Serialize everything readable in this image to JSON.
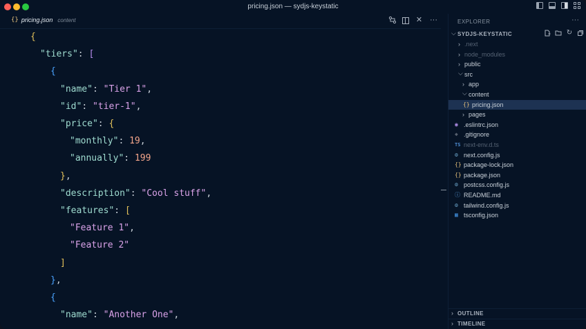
{
  "window": {
    "title": "pricing.json — sydjs-keystatic"
  },
  "tab": {
    "icon": "{}",
    "name": "pricing.json",
    "description": "content"
  },
  "tab_actions": {
    "more": "···"
  },
  "code_lines": [
    [
      [
        "{",
        "b1"
      ]
    ],
    [
      [
        "\"tiers\"",
        "k"
      ],
      [
        ": ",
        "p"
      ],
      [
        "[",
        "b2"
      ]
    ],
    [
      [
        "{",
        "b3"
      ]
    ],
    [
      [
        "\"name\"",
        "k"
      ],
      [
        ": ",
        "p"
      ],
      [
        "\"Tier 1\"",
        "s"
      ],
      [
        ",",
        "p"
      ]
    ],
    [
      [
        "\"id\"",
        "k"
      ],
      [
        ": ",
        "p"
      ],
      [
        "\"tier-1\"",
        "s"
      ],
      [
        ",",
        "p"
      ]
    ],
    [
      [
        "\"price\"",
        "k"
      ],
      [
        ": ",
        "p"
      ],
      [
        "{",
        "b1"
      ]
    ],
    [
      [
        "\"monthly\"",
        "k"
      ],
      [
        ": ",
        "p"
      ],
      [
        "19",
        "n"
      ],
      [
        ",",
        "p"
      ]
    ],
    [
      [
        "\"annually\"",
        "k"
      ],
      [
        ": ",
        "p"
      ],
      [
        "199",
        "n"
      ]
    ],
    [
      [
        "}",
        "b1"
      ],
      [
        ",",
        "p"
      ]
    ],
    [
      [
        "\"description\"",
        "k"
      ],
      [
        ": ",
        "p"
      ],
      [
        "\"Cool stuff\"",
        "s"
      ],
      [
        ",",
        "p"
      ]
    ],
    [
      [
        "\"features\"",
        "k"
      ],
      [
        ": ",
        "p"
      ],
      [
        "[",
        "b1"
      ]
    ],
    [
      [
        "\"Feature 1\"",
        "s"
      ],
      [
        ",",
        "p"
      ]
    ],
    [
      [
        "\"Feature 2\"",
        "s"
      ]
    ],
    [
      [
        "]",
        "b1"
      ]
    ],
    [
      [
        "}",
        "b3"
      ],
      [
        ",",
        "p"
      ]
    ],
    [
      [
        "{",
        "b3"
      ]
    ],
    [
      [
        "\"name\"",
        "k"
      ],
      [
        ": ",
        "p"
      ],
      [
        "\"Another One\"",
        "s"
      ],
      [
        ",",
        "p"
      ]
    ]
  ],
  "explorer": {
    "title": "EXPLORER",
    "more": "···",
    "project": "SYDJS-KEYSTATIC",
    "items": [
      {
        "label": ".next",
        "type": "folder",
        "depth": 1,
        "dim": true,
        "expanded": false
      },
      {
        "label": "node_modules",
        "type": "folder",
        "depth": 1,
        "dim": true,
        "expanded": false
      },
      {
        "label": "public",
        "type": "folder",
        "depth": 1,
        "dim": false,
        "expanded": false
      },
      {
        "label": "src",
        "type": "folder",
        "depth": 1,
        "dim": false,
        "expanded": true
      },
      {
        "label": "app",
        "type": "folder",
        "depth": 2,
        "dim": false,
        "expanded": false
      },
      {
        "label": "content",
        "type": "folder",
        "depth": 2,
        "dim": false,
        "expanded": true
      },
      {
        "label": "pricing.json",
        "type": "file",
        "icon": "json-icon",
        "glyph": "{}",
        "depth": 3,
        "dim": false,
        "selected": true
      },
      {
        "label": "pages",
        "type": "folder",
        "depth": 2,
        "dim": false,
        "expanded": false
      },
      {
        "label": ".eslintrc.json",
        "type": "file",
        "icon": "eslint-icon",
        "glyph": "◉",
        "depth": 1,
        "dim": false
      },
      {
        "label": ".gitignore",
        "type": "file",
        "icon": "git-icon",
        "glyph": "◆",
        "depth": 1,
        "dim": false
      },
      {
        "label": "next-env.d.ts",
        "type": "file",
        "icon": "typescript-icon",
        "glyph": "TS",
        "depth": 1,
        "dim": true
      },
      {
        "label": "next.config.js",
        "type": "file",
        "icon": "gear-icon",
        "glyph": "⚙",
        "depth": 1,
        "dim": false
      },
      {
        "label": "package-lock.json",
        "type": "file",
        "icon": "json-icon",
        "glyph": "{}",
        "depth": 1,
        "dim": false
      },
      {
        "label": "package.json",
        "type": "file",
        "icon": "json-icon",
        "glyph": "{}",
        "depth": 1,
        "dim": false
      },
      {
        "label": "postcss.config.js",
        "type": "file",
        "icon": "gear-icon",
        "glyph": "⚙",
        "depth": 1,
        "dim": false
      },
      {
        "label": "README.md",
        "type": "file",
        "icon": "info-icon",
        "glyph": "ⓘ",
        "depth": 1,
        "dim": false
      },
      {
        "label": "tailwind.config.js",
        "type": "file",
        "icon": "gear-icon",
        "glyph": "⚙",
        "depth": 1,
        "dim": false
      },
      {
        "label": "tsconfig.json",
        "type": "file",
        "icon": "tsconfig-icon",
        "glyph": "▦",
        "depth": 1,
        "dim": false
      }
    ],
    "outline": "OUTLINE",
    "timeline": "TIMELINE"
  }
}
